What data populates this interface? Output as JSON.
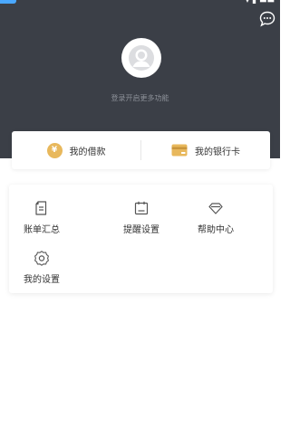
{
  "header": {
    "message_icon": "chat-bubble-icon",
    "login_hint": "登录开启更多功能",
    "avatar_icon": "user-avatar-icon",
    "bg_color": "#3b3f47"
  },
  "shortcuts": [
    {
      "label": "我的借款",
      "icon": "coin-icon"
    },
    {
      "label": "我的银行卡",
      "icon": "bank-card-icon"
    }
  ],
  "menu": [
    {
      "label": "账单汇总",
      "icon": "bill-document-icon"
    },
    {
      "label": "提醒设置",
      "icon": "calendar-icon"
    },
    {
      "label": "帮助中心",
      "icon": "diamond-icon"
    },
    {
      "label": "我的设置",
      "icon": "gear-icon"
    }
  ],
  "colors": {
    "accent_gold": "#e8b85c",
    "icon_gray": "#555555"
  }
}
